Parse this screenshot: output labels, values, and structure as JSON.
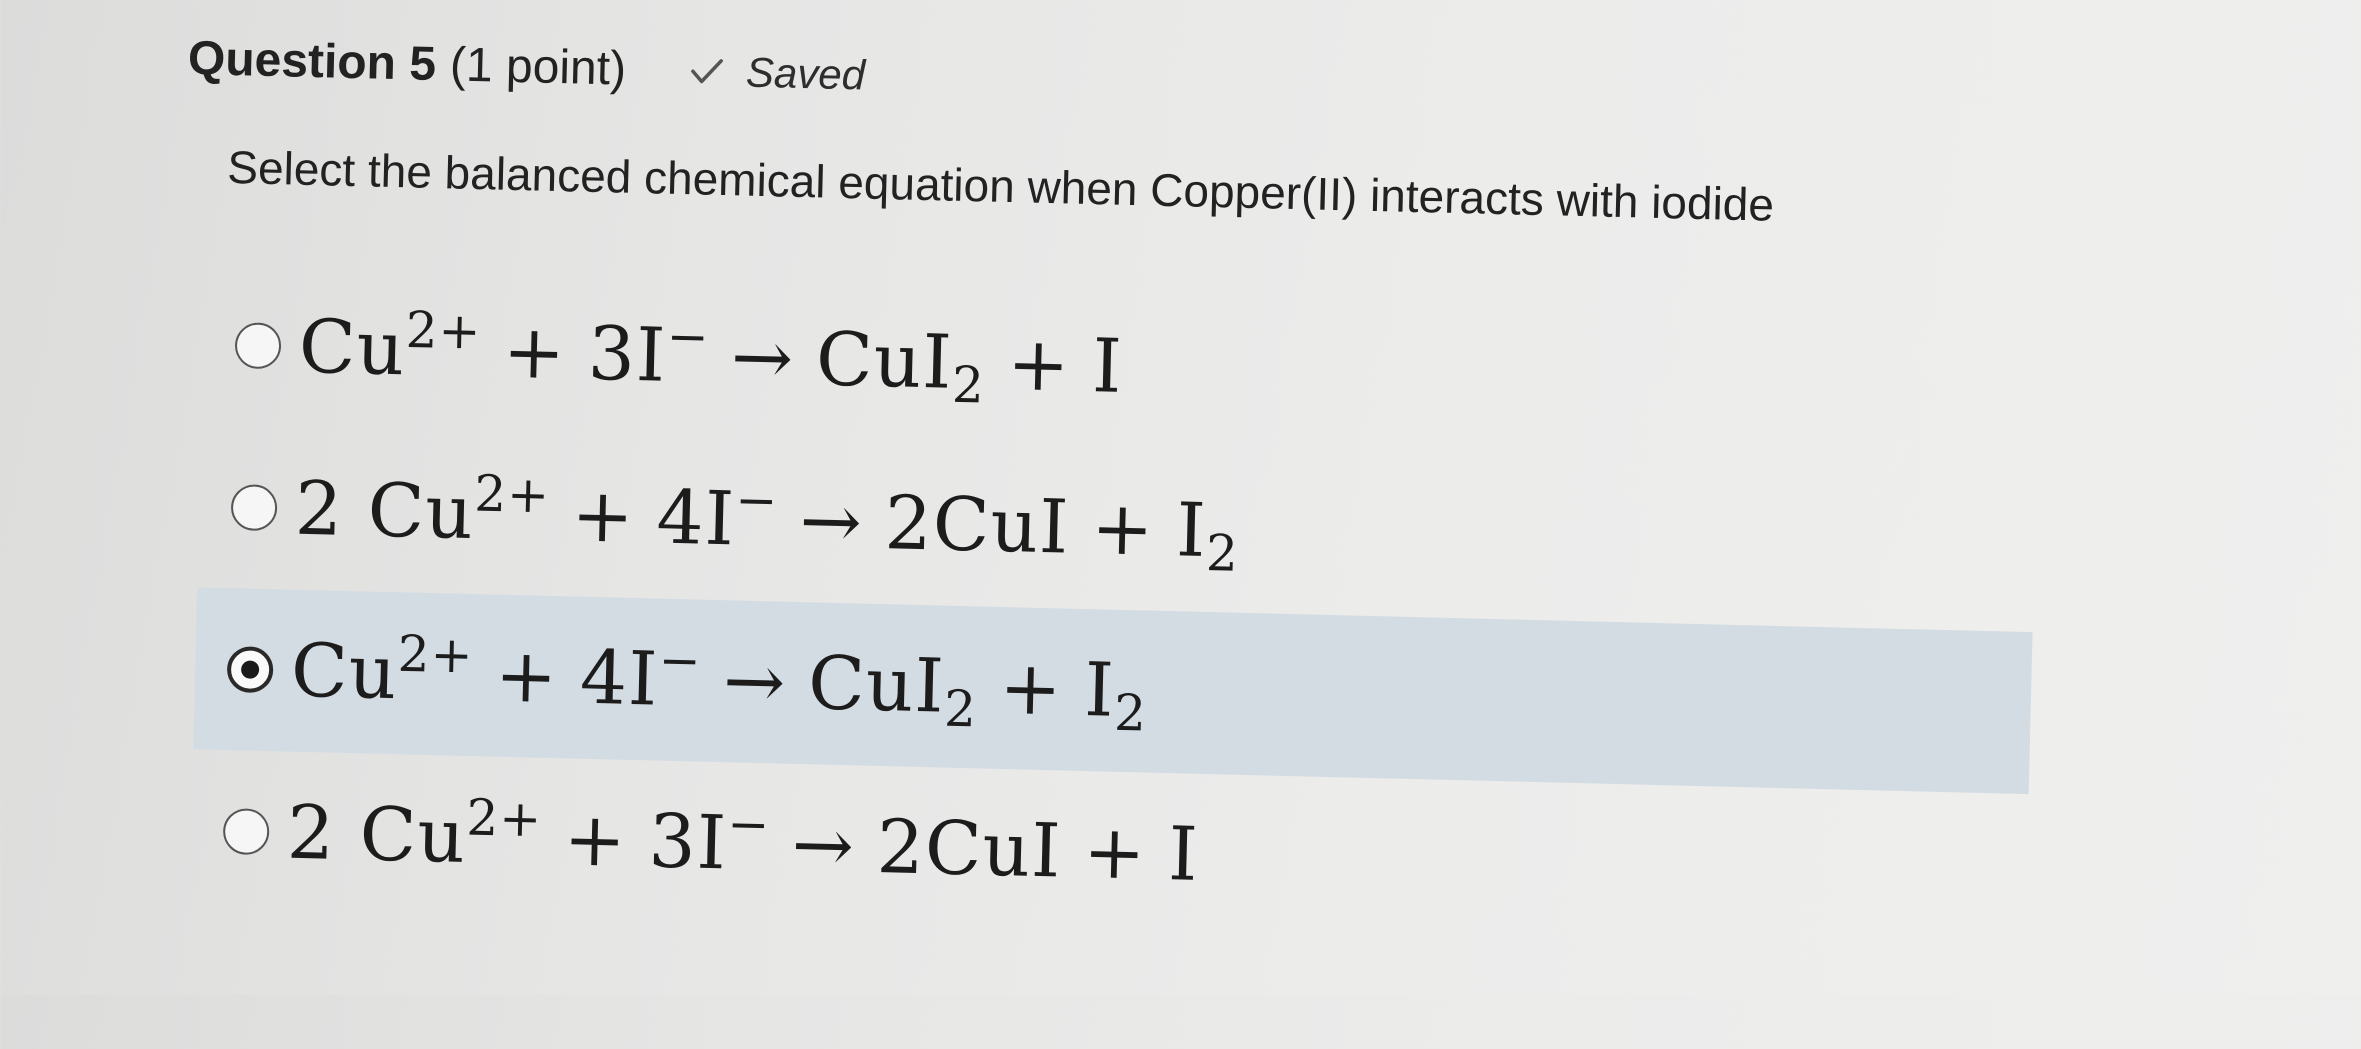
{
  "question": {
    "title": "Question 5",
    "points": "(1 point)",
    "status": "Saved",
    "status_icon": "check-icon",
    "prompt": "Select the balanced chemical equation when Copper(II) interacts with iodide"
  },
  "options": [
    {
      "selected": false,
      "lhs_coef1": "",
      "lhs_sp1": "Cu",
      "lhs_sp1_charge": "2+",
      "plus1": "+",
      "lhs_sp2": "3I",
      "lhs_sp2_charge": "−",
      "arrow": "→",
      "rhs_sp1": "CuI",
      "rhs_sp1_sub": "2",
      "plus2": "+",
      "rhs_sp2": "I",
      "rhs_sp2_sub": ""
    },
    {
      "selected": false,
      "lhs_coef1": "2",
      "lhs_sp1": "Cu",
      "lhs_sp1_charge": "2+",
      "plus1": "+",
      "lhs_sp2": "4I",
      "lhs_sp2_charge": "−",
      "arrow": "→",
      "rhs_sp1": "2CuI",
      "rhs_sp1_sub": "",
      "plus2": "+",
      "rhs_sp2": "I",
      "rhs_sp2_sub": "2"
    },
    {
      "selected": true,
      "lhs_coef1": "",
      "lhs_sp1": "Cu",
      "lhs_sp1_charge": "2+",
      "plus1": "+",
      "lhs_sp2": "4I",
      "lhs_sp2_charge": "−",
      "arrow": "→",
      "rhs_sp1": "CuI",
      "rhs_sp1_sub": "2",
      "plus2": "+",
      "rhs_sp2": "I",
      "rhs_sp2_sub": "2"
    },
    {
      "selected": false,
      "lhs_coef1": "2",
      "lhs_sp1": "Cu",
      "lhs_sp1_charge": "2+",
      "plus1": "+",
      "lhs_sp2": "3I",
      "lhs_sp2_charge": "−",
      "arrow": "→",
      "rhs_sp1": "2CuI",
      "rhs_sp1_sub": "",
      "plus2": "+",
      "rhs_sp2": "I",
      "rhs_sp2_sub": ""
    }
  ],
  "colors": {
    "selected_row_bg": "#d4dce3",
    "text": "#1c1c1c"
  }
}
